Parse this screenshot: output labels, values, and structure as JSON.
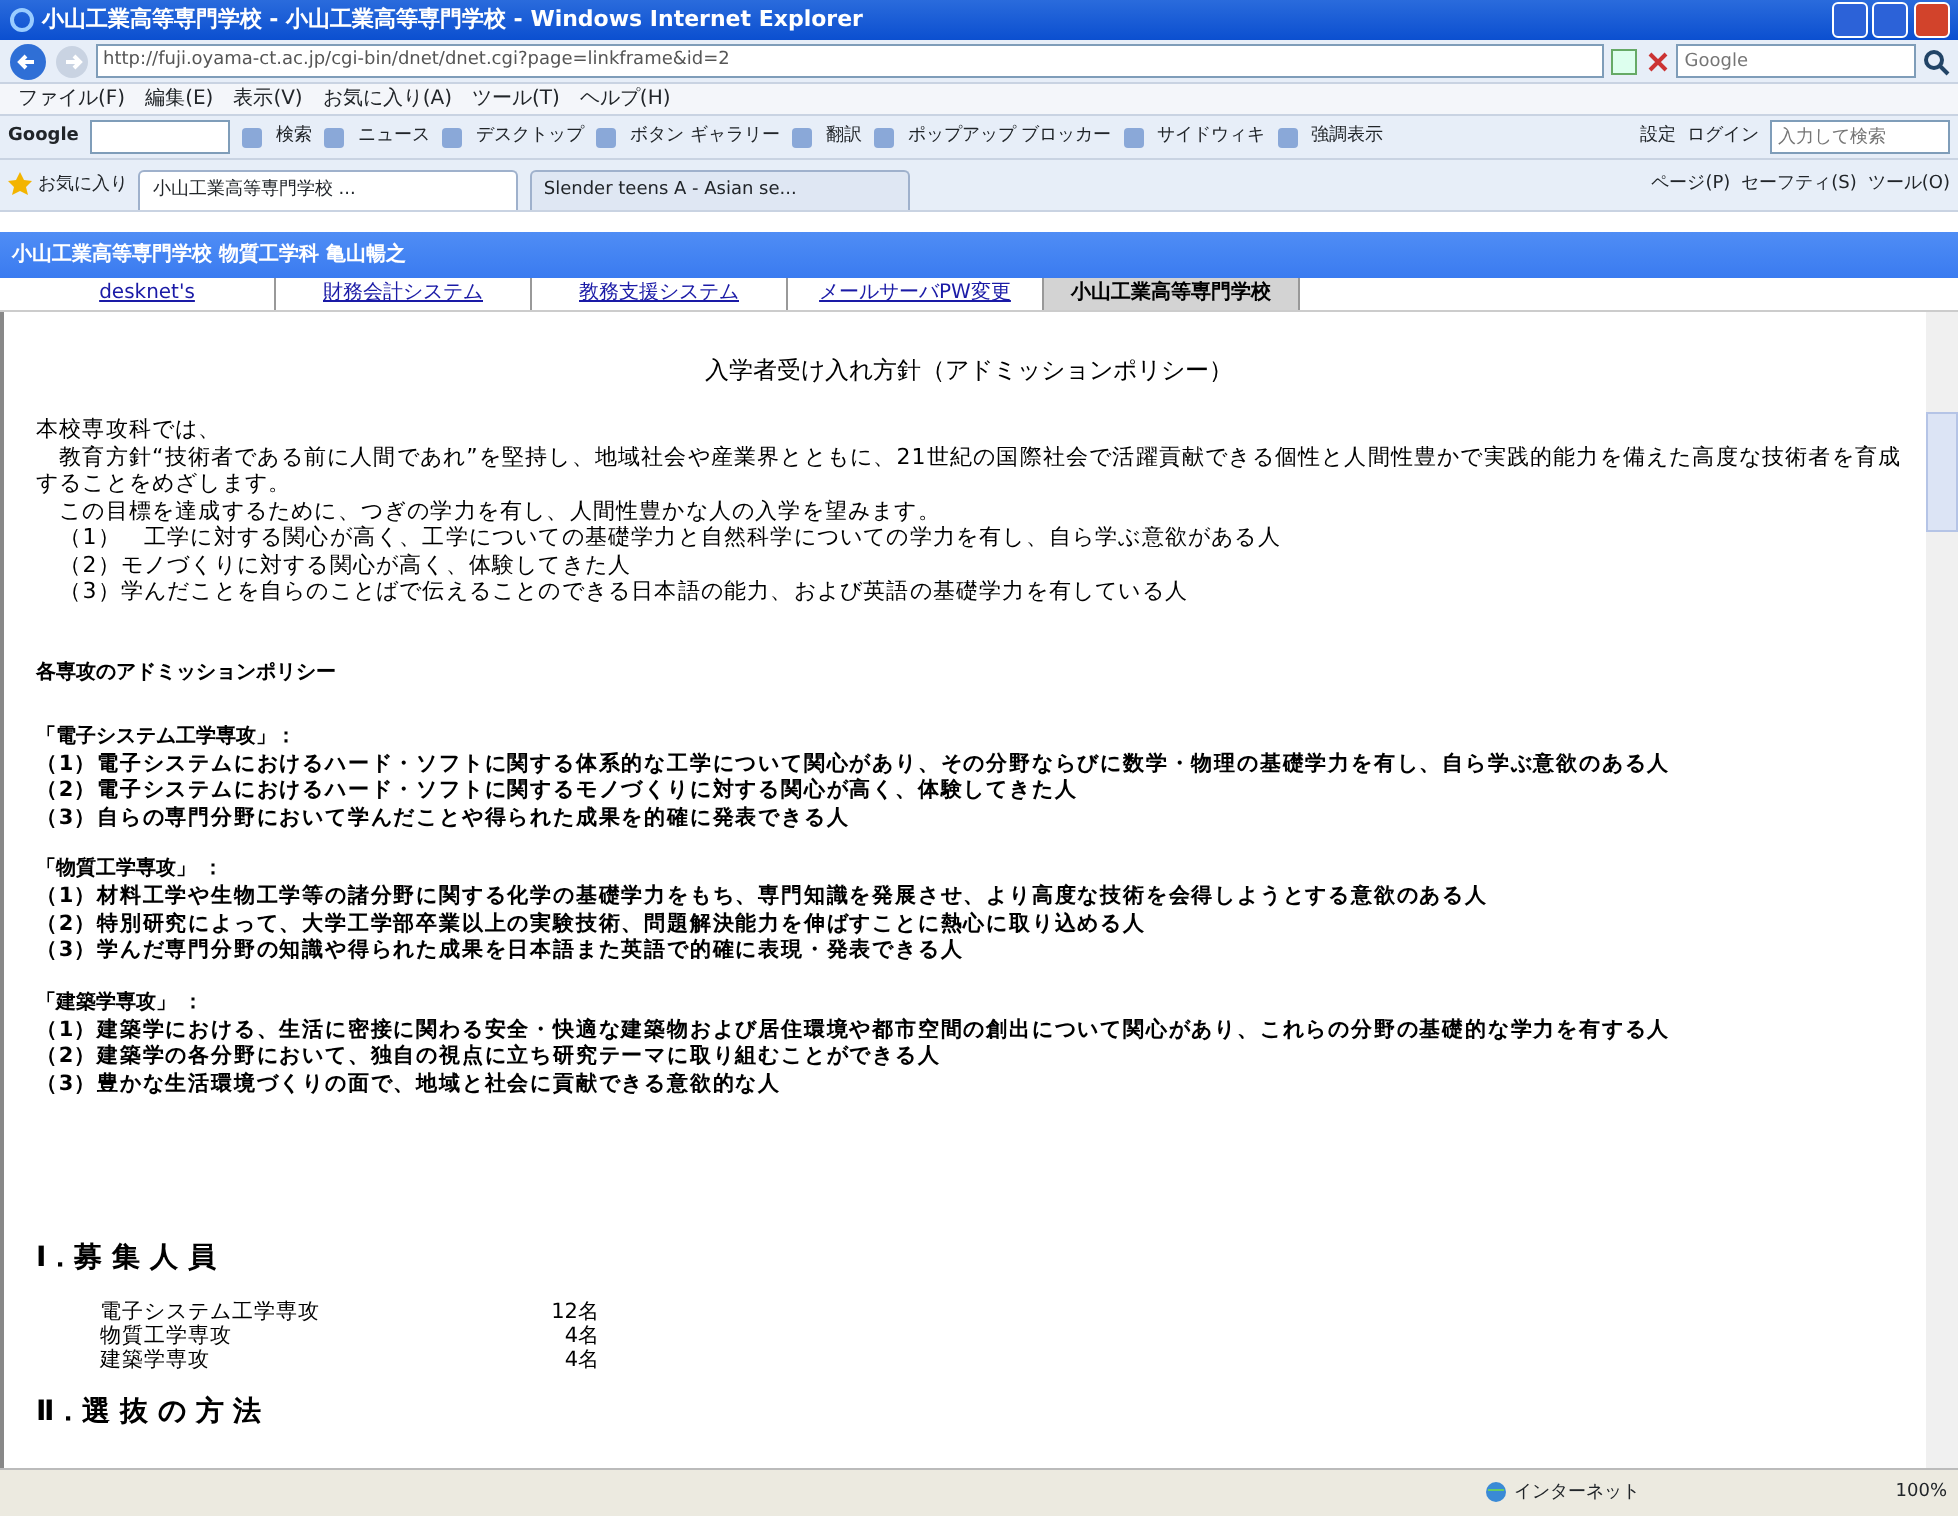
{
  "window": {
    "title": "小山工業高等専門学校 - 小山工業高等専門学校 - Windows Internet Explorer"
  },
  "address": {
    "url": "http://fuji.oyama-ct.ac.jp/cgi-bin/dnet/dnet.cgi?page=linkframe&id=2"
  },
  "search": {
    "placeholder": "Google"
  },
  "menu": [
    "ファイル(F)",
    "編集(E)",
    "表示(V)",
    "お気に入り(A)",
    "ツール(T)",
    "ヘルプ(H)"
  ],
  "google_toolbar": {
    "logo": "Google",
    "items": [
      "検索",
      "ニュース",
      "デスクトップ",
      "ボタン ギャラリー",
      "翻訳",
      "ポップアップ ブロッカー",
      "サイドウィキ",
      "強調表示"
    ],
    "right_items": [
      "設定",
      "ログイン"
    ],
    "search_placeholder": "入力して検索"
  },
  "favorites": {
    "label": "お気に入り"
  },
  "tabs": [
    {
      "label": "小山工業高等専門学校 ...",
      "selected": true
    },
    {
      "label": "Slender teens A - Asian se...",
      "selected": false
    }
  ],
  "command_bar": [
    "ページ(P)",
    "セーフティ(S)",
    "ツール(O)"
  ],
  "site_header": "小山工業高等専門学校 物質工学科 亀山暢之",
  "nav_links": [
    {
      "label": "desknet's",
      "selected": false
    },
    {
      "label": "財務会計システム",
      "selected": false
    },
    {
      "label": "教務支援システム",
      "selected": false
    },
    {
      "label": "メールサーバPW変更",
      "selected": false
    },
    {
      "label": "小山工業高等専門学校",
      "selected": true
    }
  ],
  "content": {
    "heading": "入学者受け入れ方針（アドミッションポリシー）",
    "intro": [
      "本校専攻科では、",
      "　教育方針“技術者である前に人間であれ”を堅持し、地域社会や産業界とともに、21世紀の国際社会で活躍貢献できる個性と人間性豊かで実践的能力を備えた高度な技術者を育成することをめざします。",
      "　この目標を達成するために、つぎの学力を有し、人間性豊かな人の入学を望みます。",
      "　（1）　工学に対する関心が高く、工学についての基礎学力と自然科学についての学力を有し、自ら学ぶ意欲がある人",
      "　（2）モノづくりに対する関心が高く、体験してきた人",
      "　（3）学んだことを自らのことばで伝えることのできる日本語の能力、および英語の基礎学力を有している人"
    ],
    "policy_title": "各専攻のアドミッションポリシー",
    "groups": [
      {
        "title": "「電子システム工学専攻」：",
        "items": [
          "（1）電子システムにおけるハード・ソフトに関する体系的な工学について関心があり、その分野ならびに数学・物理の基礎学力を有し、自ら学ぶ意欲のある人",
          "（2）電子システムにおけるハード・ソフトに関するモノづくりに対する関心が高く、体験してきた人",
          "（3）自らの専門分野において学んだことや得られた成果を的確に発表できる人"
        ]
      },
      {
        "title": "「物質工学専攻」 ：",
        "items": [
          "（1）材料工学や生物工学等の諸分野に関する化学の基礎学力をもち、専門知識を発展させ、より高度な技術を会得しようとする意欲のある人",
          "（2）特別研究によって、大学工学部卒業以上の実験技術、問題解決能力を伸ばすことに熱心に取り込める人",
          "（3）学んだ専門分野の知識や得られた成果を日本語また英語で的確に表現・発表できる人"
        ]
      },
      {
        "title": "「建築学専攻」 ：",
        "items": [
          "（1）建築学における、生活に密接に関わる安全・快適な建築物および居住環境や都市空間の創出について関心があり、これらの分野の基礎的な学力を有する人",
          "（2）建築学の各分野において、独自の視点に立ち研究テーマに取り組むことができる人",
          "（3）豊かな生活環境づくりの面で、地域と社会に貢献できる意欲的な人"
        ]
      }
    ],
    "recruitment": {
      "title": "Ⅰ．募 集 人 員",
      "rows": [
        {
          "department": "電子システム工学専攻",
          "count": "12名"
        },
        {
          "department": "物質工学専攻",
          "count": "4名"
        },
        {
          "department": "建築学専攻",
          "count": "4名"
        }
      ]
    },
    "selection_title": "Ⅱ．選 抜 の 方 法"
  },
  "status_bar": {
    "zone": "インターネット",
    "zoom": "100%"
  }
}
